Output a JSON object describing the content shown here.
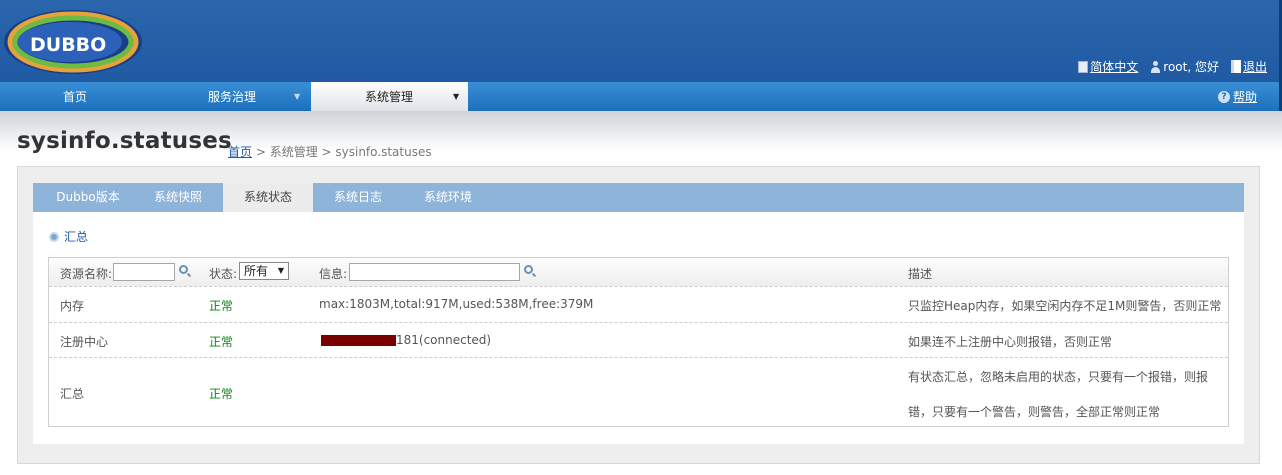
{
  "header": {
    "logo_text": "DUBBO",
    "lang_link": "简体中文",
    "user_greeting": "root, 您好",
    "logout_link": "退出"
  },
  "nav": {
    "items": [
      {
        "label": "首页"
      },
      {
        "label": "服务治理"
      },
      {
        "label": "系统管理"
      }
    ],
    "help": "帮助"
  },
  "page": {
    "title": "sysinfo.statuses",
    "breadcrumb": {
      "home": "首页",
      "rest": " > 系统管理 > sysinfo.statuses"
    }
  },
  "tabs": [
    {
      "label": "Dubbo版本"
    },
    {
      "label": "系统快照"
    },
    {
      "label": "系统状态"
    },
    {
      "label": "系统日志"
    },
    {
      "label": "系统环境"
    }
  ],
  "active_tab": "系统状态",
  "summary_link": "汇总",
  "filters": {
    "resource_label": "资源名称:",
    "resource_value": "",
    "status_label": "状态:",
    "status_selected": "所有",
    "info_label": "信息:",
    "info_value": "",
    "desc_header": "描述"
  },
  "rows": [
    {
      "name": "内存",
      "status": "正常",
      "info": "max:1803M,total:917M,used:538M,free:379M",
      "desc": "只监控Heap内存，如果空闲内存不足1M则警告，否则正常"
    },
    {
      "name": "注册中心",
      "status": "正常",
      "info": "181(connected)",
      "desc": "如果连不上注册中心则报错，否则正常"
    },
    {
      "name": "汇总",
      "status": "正常",
      "info": "",
      "desc_line1": "有状态汇总，忽略未启用的状态，只要有一个报错，则报",
      "desc_line2": "错，只要有一个警告，则警告，全部正常则正常"
    }
  ],
  "colors": {
    "header": "#2b66ad",
    "nav": "#1d6fbb",
    "tabbar": "#8fb4d9",
    "ok": "#0a8a16",
    "redaction": "#7a0000"
  }
}
